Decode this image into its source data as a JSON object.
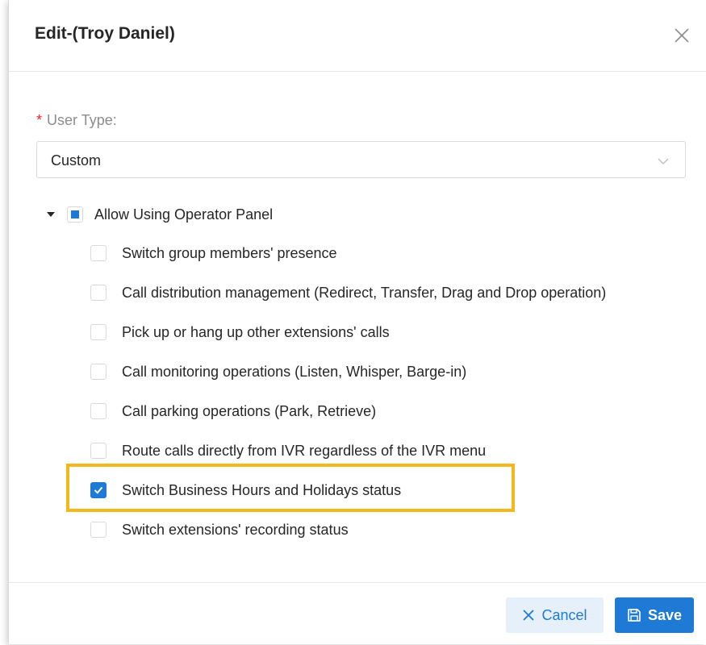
{
  "dialog": {
    "title": "Edit-(Troy Daniel)"
  },
  "user_type": {
    "required_mark": "*",
    "label": "User Type",
    "colon": ":",
    "value": "Custom"
  },
  "permissions": {
    "parent": {
      "label": "Allow Using Operator Panel",
      "state": "indeterminate"
    },
    "items": [
      {
        "label": "Switch group members' presence",
        "checked": false
      },
      {
        "label": "Call distribution management (Redirect, Transfer, Drag and Drop operation)",
        "checked": false
      },
      {
        "label": "Pick up or hang up other extensions' calls",
        "checked": false
      },
      {
        "label": "Call monitoring operations (Listen, Whisper, Barge-in)",
        "checked": false
      },
      {
        "label": "Call parking operations (Park, Retrieve)",
        "checked": false
      },
      {
        "label": "Route calls directly from IVR regardless of the IVR menu",
        "checked": false
      },
      {
        "label": "Switch Business Hours and Holidays status",
        "checked": true
      },
      {
        "label": "Switch extensions' recording status",
        "checked": false
      }
    ]
  },
  "footer": {
    "cancel_label": "Cancel",
    "save_label": "Save"
  },
  "colors": {
    "accent": "#1f7ad6",
    "highlight": "#f5b81c",
    "required": "#f5222d"
  },
  "icons": {
    "close": "close-icon",
    "dropdown": "chevron-down-icon",
    "expand": "caret-down-icon",
    "cancel": "close-icon",
    "save": "save-icon"
  }
}
